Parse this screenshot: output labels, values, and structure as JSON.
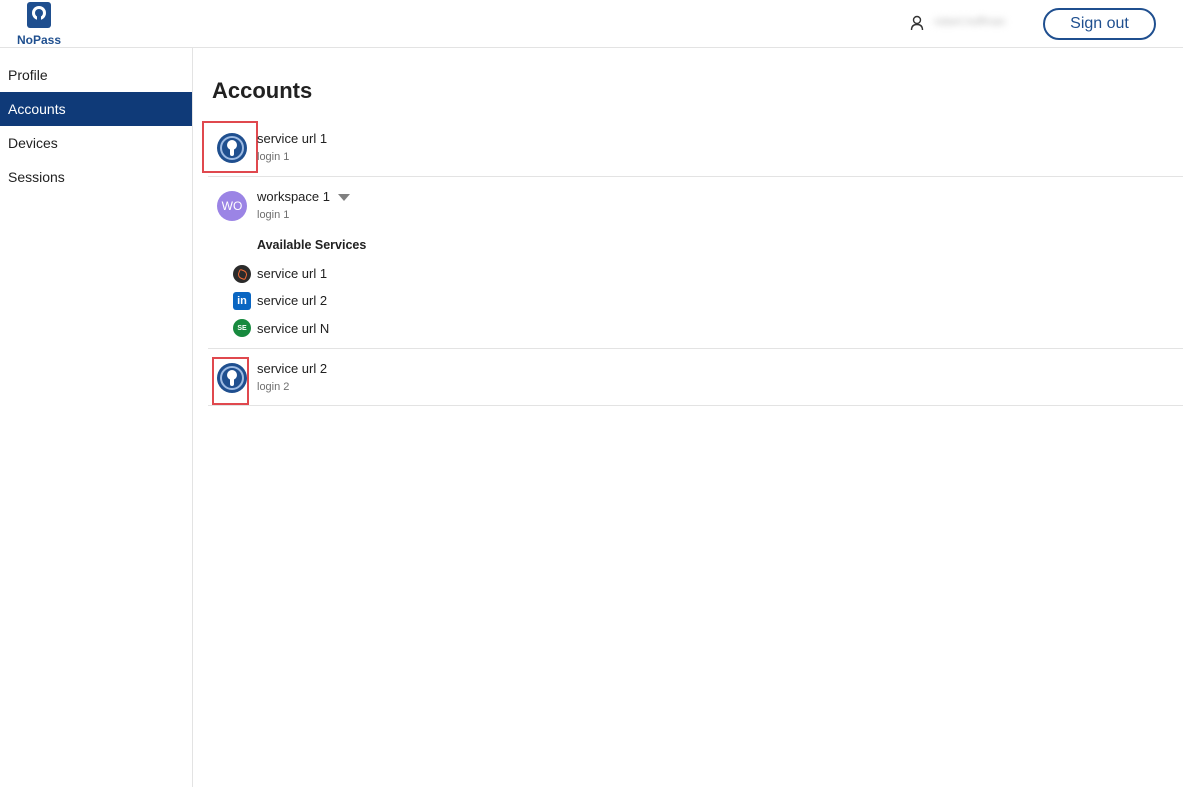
{
  "app": {
    "name": "NoPass"
  },
  "header": {
    "user_name": "robert.hoffman",
    "signout_label": "Sign out"
  },
  "sidebar": {
    "items": [
      {
        "label": "Profile",
        "active": false
      },
      {
        "label": "Accounts",
        "active": true
      },
      {
        "label": "Devices",
        "active": false
      },
      {
        "label": "Sessions",
        "active": false
      }
    ]
  },
  "main": {
    "title": "Accounts",
    "accounts": [
      {
        "title": "service url 1",
        "subtitle": "login 1",
        "icon": "nopass-key-icon"
      },
      {
        "title": "workspace 1",
        "subtitle": "login 1",
        "avatar": "WO",
        "avatar_color": "#9b84e5",
        "services_heading": "Available Services",
        "services": [
          {
            "label": "service url 1",
            "icon": "service-dark-icon",
            "badge": ""
          },
          {
            "label": "service url 2",
            "icon": "linkedin-icon",
            "badge": "in"
          },
          {
            "label": "service url N",
            "icon": "se-icon",
            "badge": "SE"
          }
        ]
      },
      {
        "title": "service url 2",
        "subtitle": "login 2",
        "icon": "nopass-key-icon"
      }
    ]
  },
  "colors": {
    "brand": "#1f4f8f",
    "nav_active": "#0f3a78",
    "highlight": "#e0484e"
  }
}
